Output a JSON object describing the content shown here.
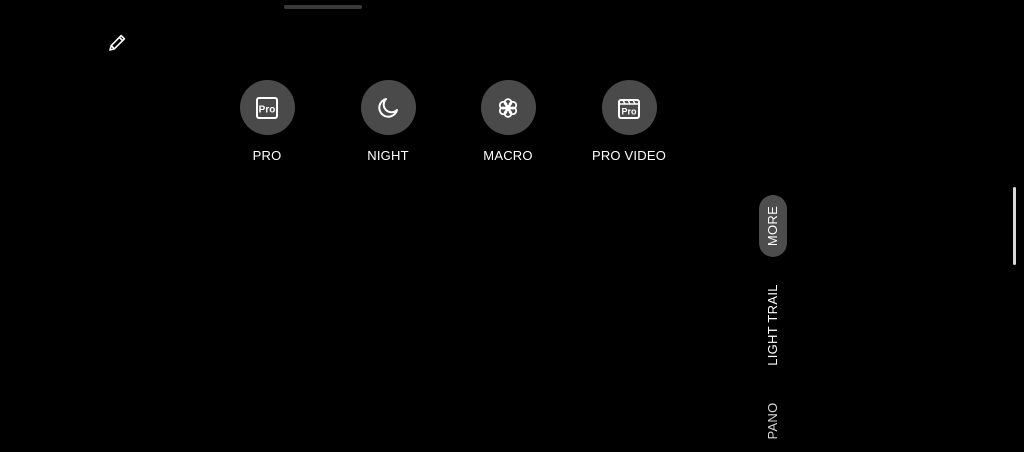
{
  "modes_grid": [
    {
      "label": "PRO",
      "icon": "pro-icon"
    },
    {
      "label": "NIGHT",
      "icon": "moon-icon"
    },
    {
      "label": "MACRO",
      "icon": "flower-icon"
    },
    {
      "label": "PRO VIDEO",
      "icon": "pro-video-icon"
    }
  ],
  "mode_icon_text": {
    "pro": "Pro",
    "pro_video": "Pro"
  },
  "side_modes": {
    "more": "MORE",
    "light_trail": "LIGHT TRAIL",
    "pano": "PANO"
  },
  "toolbar": {
    "edit_icon": "pencil-icon"
  },
  "colors": {
    "background": "#000000",
    "button_fill": "#4a4a4a",
    "selected_pill": "#4d4d4d",
    "text": "#ffffff"
  }
}
